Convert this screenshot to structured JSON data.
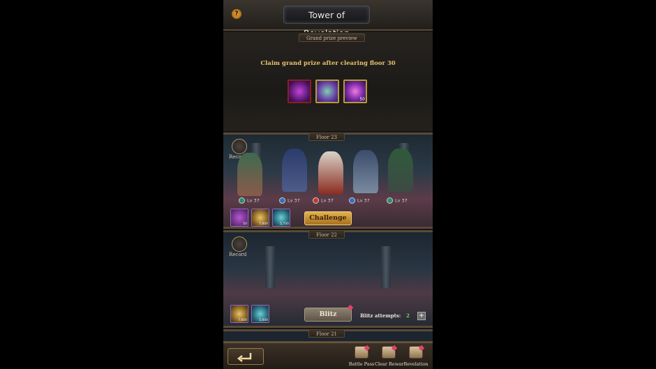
{
  "header": {
    "title": "Tower of Revelation",
    "help_label": "?"
  },
  "grand_prize": {
    "section_label": "Grand prize preview",
    "claim_text": "Claim grand prize after clearing floor 30",
    "items": [
      {
        "icon": "purple-ring-icon",
        "count": ""
      },
      {
        "icon": "crystal-orb-icon",
        "count": ""
      },
      {
        "icon": "purple-gem-icon",
        "count": "50"
      }
    ]
  },
  "floor_23": {
    "label": "Floor 23",
    "record_label": "Record",
    "heroes": [
      {
        "element": "wind",
        "level": "Lv 37",
        "color": "#2f8a6a"
      },
      {
        "element": "water",
        "level": "Lv 37",
        "color": "#2f6fbf"
      },
      {
        "element": "fire",
        "level": "Lv 37",
        "color": "#c23a2a"
      },
      {
        "element": "water",
        "level": "Lv 37",
        "color": "#2f6fbf"
      },
      {
        "element": "wind",
        "level": "Lv 37",
        "color": "#2f8a6a"
      }
    ],
    "rewards": [
      {
        "icon": "purple-scroll-icon",
        "count": "50"
      },
      {
        "icon": "gold-coin-icon",
        "count": "7,600"
      },
      {
        "icon": "blue-potion-icon",
        "count": "5,730"
      }
    ],
    "challenge_label": "Challenge"
  },
  "floor_22": {
    "label": "Floor 22",
    "record_label": "Record",
    "rewards": [
      {
        "icon": "gold-coin-icon",
        "count": "7,600"
      },
      {
        "icon": "blue-potion-icon",
        "count": "5,600"
      }
    ],
    "blitz_label": "Blitz",
    "blitz_attempts_label": "Blitz attempts:",
    "blitz_attempts_value": "2",
    "plus_label": "+"
  },
  "floor_21": {
    "label": "Floor 21"
  },
  "bottom_nav": {
    "back_icon": "return-arrow-icon",
    "items": [
      {
        "label": "Battle Pass",
        "icon": "battle-pass-icon"
      },
      {
        "label": "Clear Rewar",
        "icon": "clear-rewards-icon"
      },
      {
        "label": "Revelation",
        "icon": "revelation-icon"
      }
    ]
  },
  "colors": {
    "accent_gold": "#e7c56f",
    "badge_red": "#e0446a"
  }
}
